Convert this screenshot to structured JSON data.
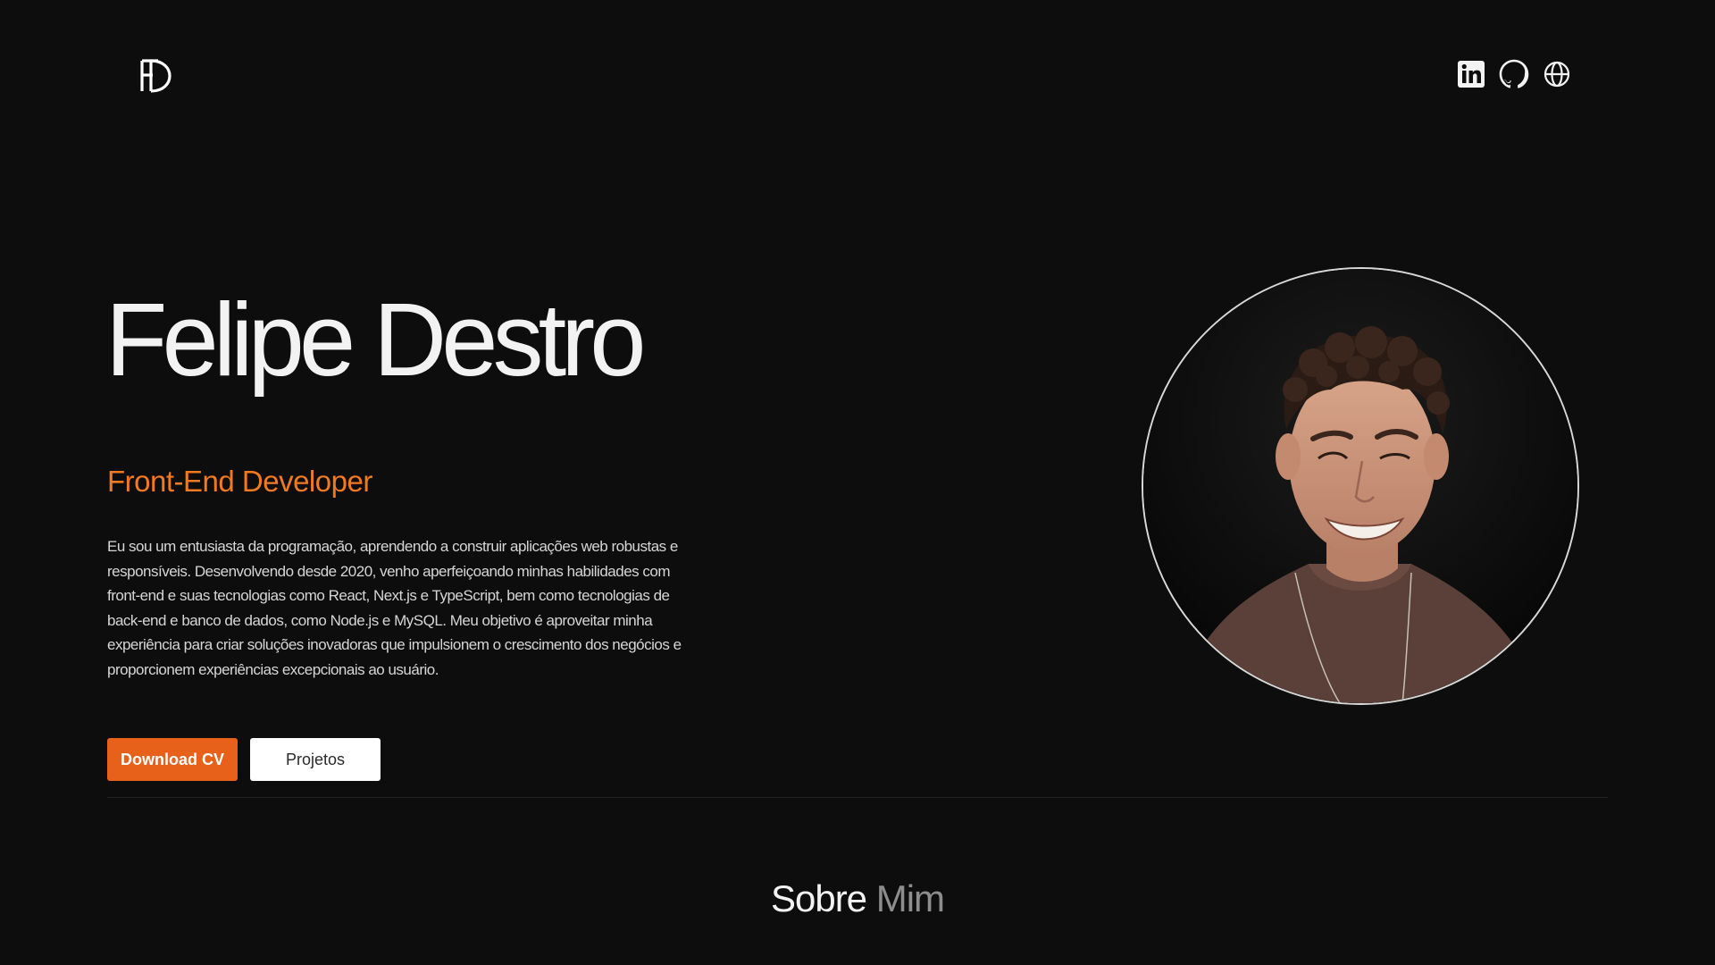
{
  "header": {
    "logo_icon": "fd-monogram-logo",
    "social": [
      {
        "name": "linkedin",
        "icon": "linkedin-icon"
      },
      {
        "name": "github",
        "icon": "github-icon"
      },
      {
        "name": "website",
        "icon": "globe-icon"
      }
    ]
  },
  "hero": {
    "name": "Felipe Destro",
    "role": "Front-End Developer",
    "bio": "Eu sou um entusiasta da programação, aprendendo a construir aplicações web robustas e responsíveis. Desenvolvendo desde 2020, venho aperfeiçoando minhas habilidades com front-end e suas tecnologias como React, Next.js e TypeScript, bem como tecnologias de back-end e banco de dados, como Node.js e MySQL. Meu objetivo é aproveitar minha experiência para criar soluções inovadoras que impulsionem o crescimento dos negócios e proporcionem experiências excepcionais ao usuário.",
    "download_label": "Download CV",
    "projects_label": "Projetos",
    "photo_icon": "profile-photo"
  },
  "about": {
    "title_part1": "Sobre",
    "title_part2": "Mim"
  },
  "colors": {
    "background": "#0d0d0d",
    "accent": "#e8611a",
    "role_text": "#f07a21"
  }
}
